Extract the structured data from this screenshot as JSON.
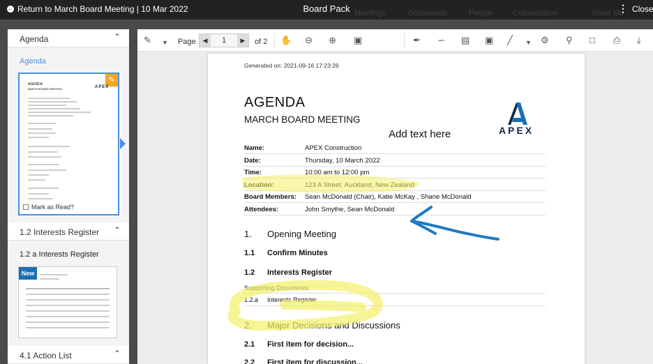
{
  "topbar": {
    "back_label": "Return to March Board Meeting | 10 Mar 2022",
    "title": "Board Pack",
    "close_label": "Close",
    "ghost_labels": [
      "Meetings",
      "Documents",
      "People",
      "Collaboration",
      "Show Me"
    ]
  },
  "sidebar": {
    "agenda_header": "Agenda",
    "agenda_item": "Agenda",
    "mark_as_read": "Mark as Read?",
    "interests_header": "1.2 Interests Register",
    "interests_item": "1.2 a Interests Register",
    "new_badge": "New",
    "action_header": "4.1 Action List"
  },
  "toolbar": {
    "page_label": "Page",
    "page_value": "1",
    "page_total": "of 2"
  },
  "document": {
    "generated": "Generated on: 2021-09-16 17:23:26",
    "title": "AGENDA",
    "subtitle": "MARCH BOARD MEETING",
    "logo_text": "APEX",
    "annotation_text": "Add text here",
    "details": [
      {
        "key": "Name:",
        "value": "APEX Construction"
      },
      {
        "key": "Date:",
        "value": "Thursday, 10 March 2022"
      },
      {
        "key": "Time:",
        "value": "10:00 am  to  12:00 pm"
      },
      {
        "key": "Location:",
        "value": "123 A Street, Auckland, New Zealand"
      },
      {
        "key": "Board Members:",
        "value": "Sean McDonald (Chair), Katie McKay , Shane McDonald"
      },
      {
        "key": "Attendees:",
        "value": "John Smythe, Sean McDonald"
      }
    ],
    "section1": {
      "num": "1.",
      "label": "Opening Meeting"
    },
    "item11": {
      "num": "1.1",
      "label": "Confirm Minutes"
    },
    "item12": {
      "num": "1.2",
      "label": "Interests Register"
    },
    "supporting": "Supporting Documents:",
    "doc12a": {
      "num": "1.2.a",
      "label": "Interests Register"
    },
    "section2": {
      "num": "2.",
      "label": "Major Decisions and Discussions"
    },
    "item21": {
      "num": "2.1",
      "label": "First item for decision..."
    },
    "item22": {
      "num": "2.2",
      "label": "First item for discussion..."
    }
  },
  "colors": {
    "accent": "#4a90e2",
    "highlight": "#f7f36a",
    "pen": "#1f7ac4",
    "badge_orange": "#f5a623",
    "badge_new": "#1a6fb3"
  }
}
